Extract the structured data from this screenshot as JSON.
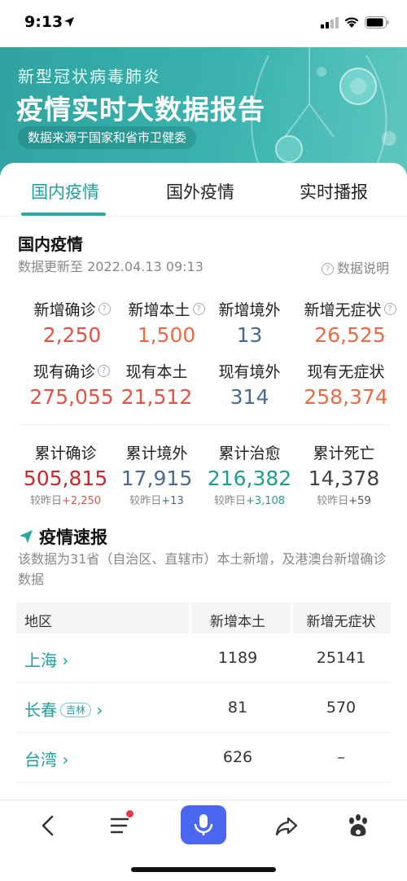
{
  "status_bar": {
    "time": "9:13"
  },
  "banner": {
    "subtitle": "新型冠状病毒肺炎",
    "title": "疫情实时大数据报告",
    "source": "数据来源于国家和省市卫健委"
  },
  "tabs": [
    {
      "label": "国内疫情",
      "active": true
    },
    {
      "label": "国外疫情",
      "active": false
    },
    {
      "label": "实时播报",
      "active": false
    }
  ],
  "domestic": {
    "title": "国内疫情",
    "update_time": "数据更新至 2022.04.13 09:13",
    "explain": "数据说明",
    "new_row": [
      {
        "label": "新增确诊",
        "value": "2,250"
      },
      {
        "label": "新增本土",
        "value": "1,500"
      },
      {
        "label": "新增境外",
        "value": "13"
      },
      {
        "label": "新增无症状",
        "value": "26,525"
      }
    ],
    "current_row": [
      {
        "label": "现有确诊",
        "value": "275,055"
      },
      {
        "label": "现有本土",
        "value": "21,512"
      },
      {
        "label": "现有境外",
        "value": "314"
      },
      {
        "label": "现有无症状",
        "value": "258,374"
      }
    ],
    "cumulative_row": [
      {
        "label": "累计确诊",
        "value": "505,815",
        "delta_prefix": "较昨日",
        "delta": "+2,250"
      },
      {
        "label": "累计境外",
        "value": "17,915",
        "delta_prefix": "较昨日",
        "delta": "+13"
      },
      {
        "label": "累计治愈",
        "value": "216,382",
        "delta_prefix": "较昨日",
        "delta": "+3,108"
      },
      {
        "label": "累计死亡",
        "value": "14,378",
        "delta_prefix": "较昨日",
        "delta": "+59"
      }
    ]
  },
  "news": {
    "title": "疫情速报",
    "desc": "该数据为31省（自治区、直辖市）本土新增，及港澳台新增确诊数据",
    "table": {
      "headers": [
        "地区",
        "新增本土",
        "新增无症状"
      ],
      "rows": [
        {
          "region": "上海",
          "tag": "",
          "local": "1189",
          "asymptomatic": "25141"
        },
        {
          "region": "长春",
          "tag": "吉林",
          "local": "81",
          "asymptomatic": "570"
        },
        {
          "region": "台湾",
          "tag": "",
          "local": "626",
          "asymptomatic": "–"
        }
      ]
    }
  },
  "colors": {
    "accent": "#2aa7a3",
    "confirmed_red": "#e65045",
    "overseas_blue": "#4a6a93",
    "cured_teal": "#1d9e8f",
    "mic_blue": "#4b67f2"
  }
}
